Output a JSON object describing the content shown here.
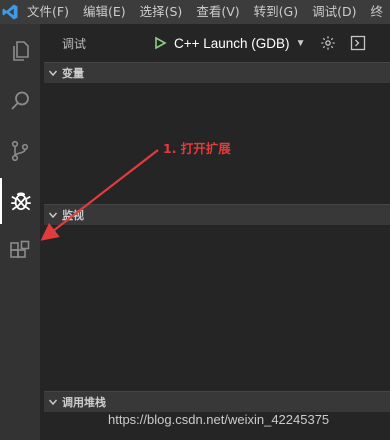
{
  "menubar": {
    "items": [
      "文件(F)",
      "编辑(E)",
      "选择(S)",
      "查看(V)",
      "转到(G)",
      "调试(D)",
      "终"
    ]
  },
  "activity_bar": {
    "icons": [
      "files-icon",
      "search-icon",
      "source-control-icon",
      "debug-icon",
      "extensions-icon"
    ],
    "active": "debug-icon"
  },
  "debug_toolbar": {
    "title": "调试",
    "config": "C++ Launch (GDB)"
  },
  "sections": {
    "variables": "变量",
    "watch": "监视",
    "call_stack": "调用堆栈"
  },
  "annotation": {
    "text": "1. 打开扩展",
    "color": "#e23b3b"
  },
  "watermark": "https://blog.csdn.net/weixin_42245375",
  "colors": {
    "menubar": "#3c3c3c",
    "activitybar": "#333333",
    "sidebar": "#252526",
    "vscode_logo": "#3e9ae6",
    "play_green": "#89d185"
  }
}
